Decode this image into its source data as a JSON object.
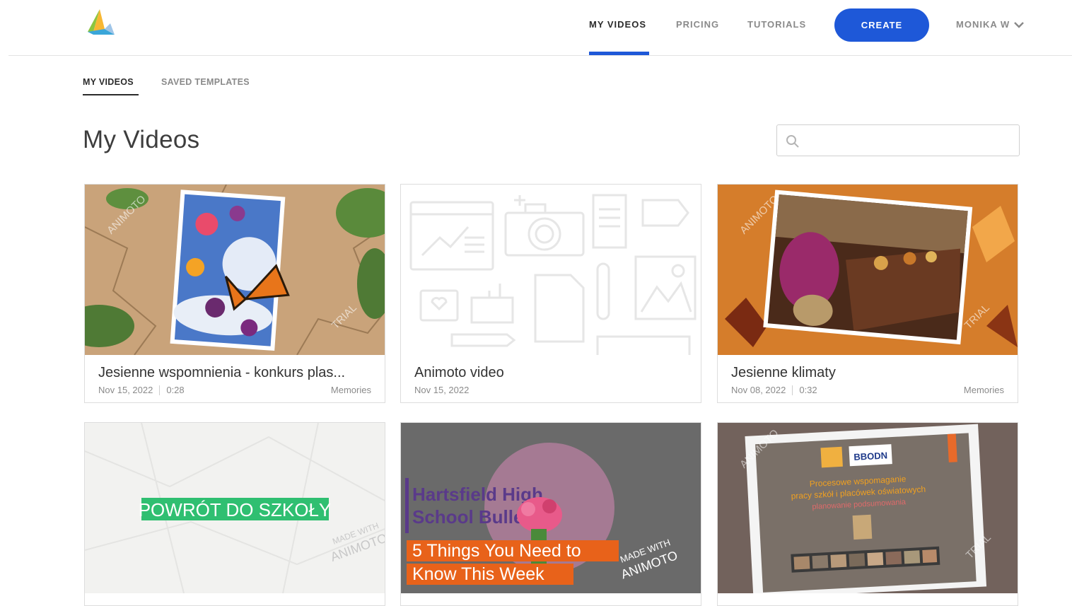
{
  "nav": {
    "links": [
      "MY VIDEOS",
      "PRICING",
      "TUTORIALS"
    ],
    "create_label": "CREATE",
    "user_label": "MONIKA W"
  },
  "subtabs": [
    "MY VIDEOS",
    "SAVED TEMPLATES"
  ],
  "page_title": "My Videos",
  "search": {
    "value": "",
    "placeholder": ""
  },
  "colors": {
    "accent": "#1e58d8"
  },
  "videos": [
    {
      "title": "Jesienne wspomnienia - konkurs plas...",
      "date": "Nov 15, 2022",
      "duration": "0:28",
      "category": "Memories",
      "watermark": "ANIMOTO",
      "trial_mark": "TRIAL"
    },
    {
      "title": "Animoto video",
      "date": "Nov 15, 2022"
    },
    {
      "title": "Jesienne klimaty",
      "date": "Nov 08, 2022",
      "duration": "0:32",
      "category": "Memories",
      "watermark": "ANIMOTO",
      "trial_mark": "TRIAL"
    },
    {
      "overlay_text": "POWRÓT DO SZKOŁY",
      "made_with": "MADE WITH",
      "brand": "ANIMOTO"
    },
    {
      "headline_1": "Hartsfield High",
      "headline_2": "School Bulletin",
      "banner_1": "5 Things You Need to",
      "banner_2": "Know This Week",
      "made_with": "MADE WITH",
      "brand": "ANIMOTO"
    },
    {
      "org_line": "BBODN",
      "slide_line_1": "Procesowe wspomaganie",
      "slide_line_2": "pracy szkół i placówek oświatowych",
      "slide_line_3": "planowanie podsumowania",
      "watermark": "ANIMOTO",
      "trial_mark": "TRIAL"
    }
  ]
}
